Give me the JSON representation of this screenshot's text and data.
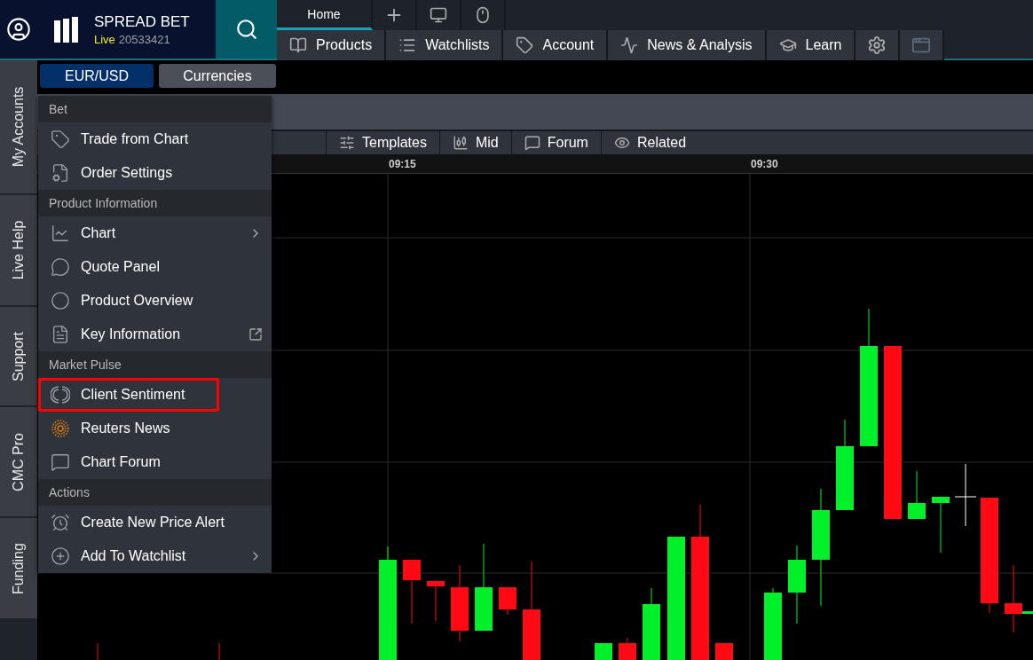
{
  "account": {
    "brand": "SPREAD BET",
    "mode": "Live",
    "number": "20533421"
  },
  "top_tabs": [
    {
      "label": "Home",
      "selected": true
    }
  ],
  "nav": [
    "Products",
    "Watchlists",
    "Account",
    "News & Analysis",
    "Learn"
  ],
  "instrument": {
    "symbol": "EUR/USD",
    "category": "Currencies"
  },
  "chart_toolbar": [
    "Templates",
    "Mid",
    "Forum",
    "Related"
  ],
  "time_labels": [
    "09:15",
    "09:30"
  ],
  "side_tabs": [
    "My Accounts",
    "Live Help",
    "Support",
    "CMC Pro",
    "Funding"
  ],
  "context_menu": {
    "sections": [
      {
        "title": "Bet",
        "items": [
          {
            "label": "Trade from Chart",
            "kind": "plain",
            "highlighted": false
          },
          {
            "label": "Order Settings",
            "kind": "plain",
            "highlighted": false
          }
        ]
      },
      {
        "title": "Product Information",
        "items": [
          {
            "label": "Chart",
            "kind": "submenu",
            "highlighted": false
          },
          {
            "label": "Quote Panel",
            "kind": "plain",
            "highlighted": false
          },
          {
            "label": "Product Overview",
            "kind": "plain",
            "highlighted": false
          },
          {
            "label": "Key Information",
            "kind": "external",
            "highlighted": false
          }
        ]
      },
      {
        "title": "Market Pulse",
        "items": [
          {
            "label": "Client Sentiment",
            "kind": "plain",
            "highlighted": true
          },
          {
            "label": "Reuters News",
            "kind": "plain",
            "highlighted": false
          },
          {
            "label": "Chart Forum",
            "kind": "plain",
            "highlighted": false
          }
        ]
      },
      {
        "title": "Actions",
        "items": [
          {
            "label": "Create New Price Alert",
            "kind": "plain",
            "highlighted": false
          },
          {
            "label": "Add To Watchlist",
            "kind": "submenu",
            "highlighted": false
          }
        ]
      }
    ]
  }
}
